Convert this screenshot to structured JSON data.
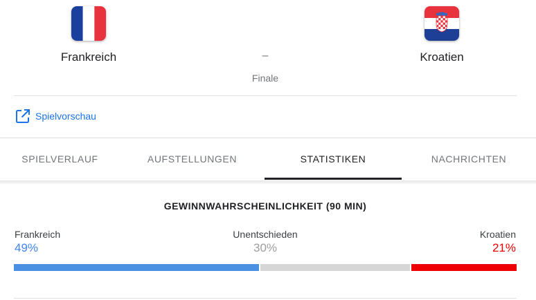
{
  "match": {
    "home_team": "Frankreich",
    "away_team": "Kroatien",
    "score_separator": "–",
    "stage": "Finale",
    "home_flag_icon": "france-flag-icon",
    "away_flag_icon": "croatia-flag-icon"
  },
  "preview_link": {
    "label": "Spielvorschau",
    "icon": "open-in-new-icon",
    "color": "#1a73e8"
  },
  "tabs": [
    {
      "label": "SPIELVERLAUF",
      "active": false
    },
    {
      "label": "AUFSTELLUNGEN",
      "active": false
    },
    {
      "label": "STATISTIKEN",
      "active": true
    },
    {
      "label": "NACHRICHTEN",
      "active": false
    }
  ],
  "win_probability": {
    "title": "GEWINNWAHRSCHEINLICHKEIT (90 MIN)",
    "home": {
      "label": "Frankreich",
      "value": "49%",
      "fraction": 0.49,
      "color": "#4a90e2"
    },
    "draw": {
      "label": "Unentschieden",
      "value": "30%",
      "fraction": 0.3,
      "color": "#d6d6d6"
    },
    "away": {
      "label": "Kroatien",
      "value": "21%",
      "fraction": 0.21,
      "color": "#ee0000"
    }
  }
}
